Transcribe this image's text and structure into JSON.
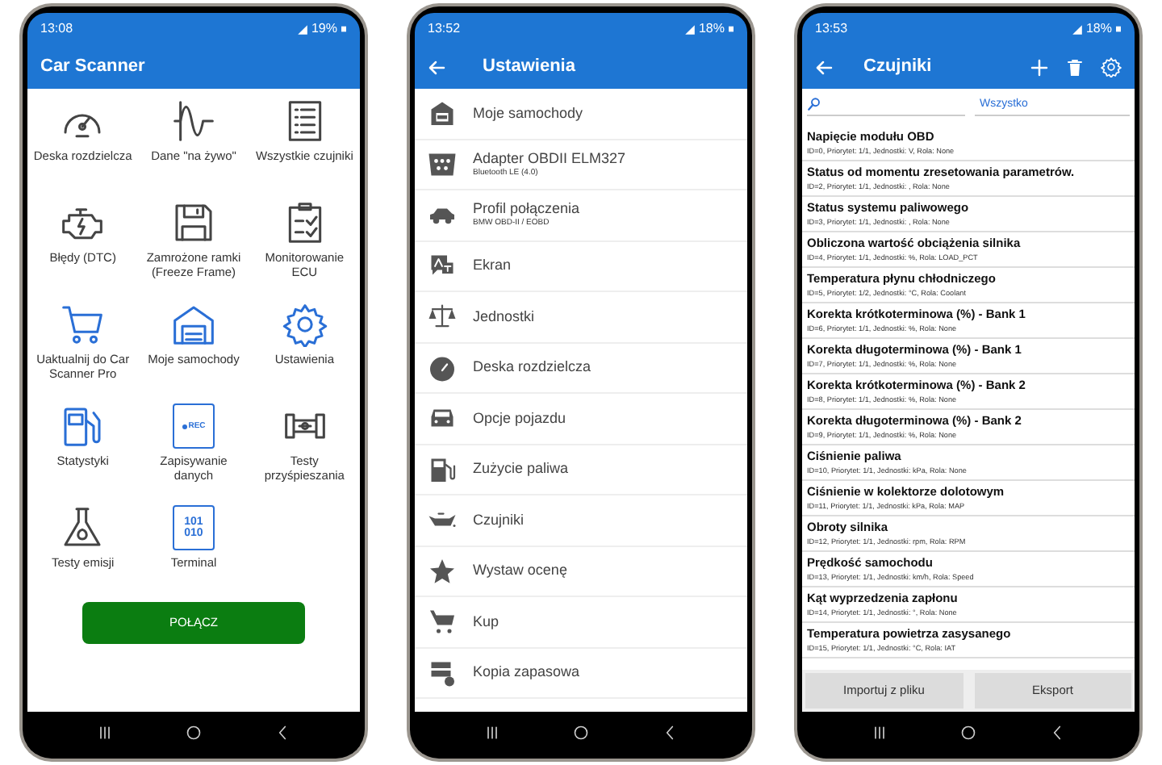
{
  "home_screen": {
    "status_bar": {
      "time": "13:08",
      "battery": "19%"
    },
    "title": "Car Scanner",
    "tiles": [
      {
        "label": "Deska rozdzielcza"
      },
      {
        "label": "Dane \"na żywo\""
      },
      {
        "label": "Wszystkie czujniki"
      },
      {
        "label": "Błędy (DTC)"
      },
      {
        "label": "Zamrożone ramki (Freeze Frame)"
      },
      {
        "label": "Monitorowanie ECU"
      },
      {
        "label": "Uaktualnij do Car Scanner Pro"
      },
      {
        "label": "Moje samochody"
      },
      {
        "label": "Ustawienia"
      },
      {
        "label": "Statystyki"
      },
      {
        "label": "Zapisywanie danych",
        "icon_text": [
          "REC"
        ]
      },
      {
        "label": "Testy przyśpieszania"
      },
      {
        "label": "Testy emisji"
      },
      {
        "label": "Terminal",
        "icon_text": [
          "101",
          "010"
        ]
      }
    ],
    "connect_button": "POŁĄCZ"
  },
  "settings_screen": {
    "status_bar": {
      "time": "13:52",
      "battery": "18%"
    },
    "title": "Ustawienia",
    "items": [
      {
        "label": "Moje samochody"
      },
      {
        "label": "Adapter OBDII ELM327",
        "sublabel": "Bluetooth LE (4.0)"
      },
      {
        "label": "Profil połączenia",
        "sublabel": "BMW OBD-II / EOBD"
      },
      {
        "label": "Ekran"
      },
      {
        "label": "Jednostki"
      },
      {
        "label": "Deska rozdzielcza"
      },
      {
        "label": "Opcje pojazdu"
      },
      {
        "label": "Zużycie paliwa"
      },
      {
        "label": "Czujniki"
      },
      {
        "label": "Wystaw ocenę"
      },
      {
        "label": "Kup"
      },
      {
        "label": "Kopia zapasowa"
      }
    ]
  },
  "sensors_screen": {
    "status_bar": {
      "time": "13:53",
      "battery": "18%"
    },
    "title": "Czujniki",
    "filter": "Wszystko",
    "sensors": [
      {
        "name": "Napięcie modułu OBD",
        "details": "ID=0, Priorytet: 1/1, Jednostki: V, Rola: None"
      },
      {
        "name": "Status od momentu zresetowania parametrów.",
        "details": "ID=2, Priorytet: 1/1, Jednostki: , Rola: None"
      },
      {
        "name": "Status systemu paliwowego",
        "details": "ID=3, Priorytet: 1/1, Jednostki: , Rola: None"
      },
      {
        "name": "Obliczona wartość obciążenia silnika",
        "details": "ID=4, Priorytet: 1/1, Jednostki: %, Rola: LOAD_PCT"
      },
      {
        "name": "Temperatura płynu chłodniczego",
        "details": "ID=5, Priorytet: 1/2, Jednostki: °C, Rola: Coolant"
      },
      {
        "name": "Korekta krótkoterminowa (%) - Bank 1",
        "details": "ID=6, Priorytet: 1/1, Jednostki: %, Rola: None"
      },
      {
        "name": "Korekta długoterminowa (%) - Bank 1",
        "details": "ID=7, Priorytet: 1/1, Jednostki: %, Rola: None"
      },
      {
        "name": "Korekta krótkoterminowa (%) - Bank 2",
        "details": "ID=8, Priorytet: 1/1, Jednostki: %, Rola: None"
      },
      {
        "name": "Korekta długoterminowa (%) - Bank 2",
        "details": "ID=9, Priorytet: 1/1, Jednostki: %, Rola: None"
      },
      {
        "name": "Ciśnienie paliwa",
        "details": "ID=10, Priorytet: 1/1, Jednostki: kPa, Rola: None"
      },
      {
        "name": "Ciśnienie w kolektorze dolotowym",
        "details": "ID=11, Priorytet: 1/1, Jednostki: kPa, Rola: MAP"
      },
      {
        "name": "Obroty silnika",
        "details": "ID=12, Priorytet: 1/1, Jednostki: rpm, Rola: RPM"
      },
      {
        "name": "Prędkość samochodu",
        "details": "ID=13, Priorytet: 1/1, Jednostki: km/h, Rola: Speed"
      },
      {
        "name": "Kąt wyprzedzenia zapłonu",
        "details": "ID=14, Priorytet: 1/1, Jednostki: °, Rola: None"
      },
      {
        "name": "Temperatura powietrza zasysanego",
        "details": "ID=15, Priorytet: 1/1, Jednostki: °C, Rola: IAT"
      }
    ],
    "buttons": [
      "Importuj z pliku",
      "Eksport"
    ]
  }
}
